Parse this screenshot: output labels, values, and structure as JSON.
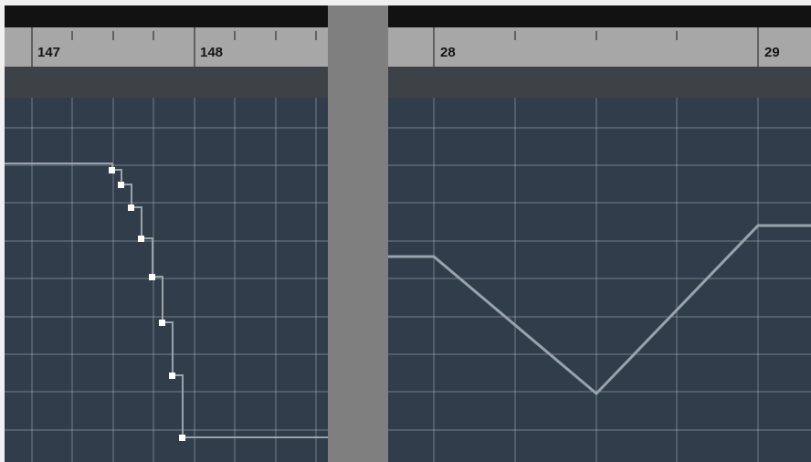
{
  "left_editor": {
    "ruler": {
      "bar_labels": [
        "147",
        "148"
      ]
    },
    "automation": {
      "mode": "step",
      "start_level": 1.0,
      "end_level": 0.0,
      "node_count": 8
    }
  },
  "right_editor": {
    "ruler": {
      "bar_labels": [
        "28",
        "29"
      ]
    },
    "automation": {
      "mode": "ramp",
      "start_level": 0.65,
      "low_level": 0.15,
      "end_level": 0.75
    }
  },
  "colors": {
    "grid_background": "#323d4b",
    "grid_line": "#aeb6c0",
    "automation_line": "#9aa3ad",
    "node_fill": "#ffffff",
    "ruler": "#a7a7a7",
    "top_bar": "#121212",
    "sub_bar": "#3d4247",
    "divider": "#7f7f7f"
  }
}
